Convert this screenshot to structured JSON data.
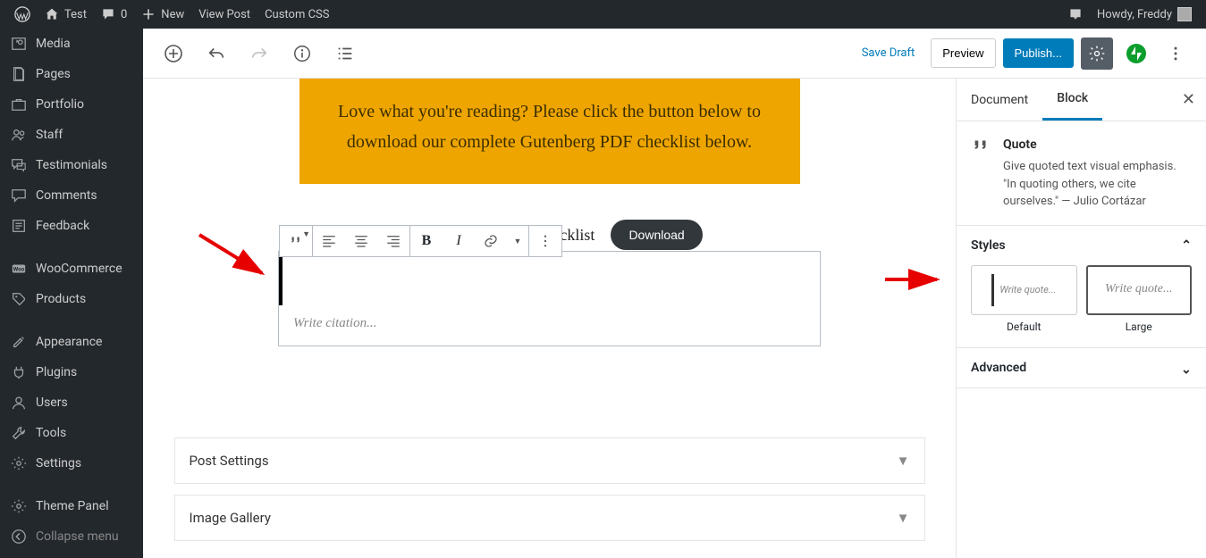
{
  "admin_bar": {
    "site_name": "Test",
    "comments_count": "0",
    "new_label": "New",
    "view_post": "View Post",
    "custom_css": "Custom CSS",
    "howdy": "Howdy, Freddy"
  },
  "admin_menu": [
    {
      "label": "Media",
      "icon": "media"
    },
    {
      "label": "Pages",
      "icon": "page"
    },
    {
      "label": "Portfolio",
      "icon": "portfolio"
    },
    {
      "label": "Staff",
      "icon": "users"
    },
    {
      "label": "Testimonials",
      "icon": "chat"
    },
    {
      "label": "Comments",
      "icon": "comment"
    },
    {
      "label": "Feedback",
      "icon": "form"
    }
  ],
  "admin_menu2": [
    {
      "label": "WooCommerce",
      "icon": "woo"
    },
    {
      "label": "Products",
      "icon": "product"
    }
  ],
  "admin_menu3": [
    {
      "label": "Appearance",
      "icon": "appearance"
    },
    {
      "label": "Plugins",
      "icon": "plugin"
    },
    {
      "label": "Users",
      "icon": "user"
    },
    {
      "label": "Tools",
      "icon": "tool"
    },
    {
      "label": "Settings",
      "icon": "settings"
    }
  ],
  "admin_menu4": [
    {
      "label": "Theme Panel",
      "icon": "settings"
    },
    {
      "label": "Collapse menu",
      "icon": "collapse"
    }
  ],
  "editor_header": {
    "save_draft": "Save Draft",
    "preview": "Preview",
    "publish": "Publish..."
  },
  "canvas": {
    "yellow_text": "Love what you're reading? Please click the button below to download our complete Gutenberg PDF checklist below.",
    "pdf_label": "Free Gutenberg PDF Checklist",
    "download": "Download",
    "citation_ph": "Write citation...",
    "sections": [
      "Post Settings",
      "Image Gallery"
    ]
  },
  "panel": {
    "tabs": [
      "Document",
      "Block"
    ],
    "block_title": "Quote",
    "block_desc": "Give quoted text visual emphasis. \"In quoting others, we cite ourselves.\" — Julio Cortázar",
    "styles_title": "Styles",
    "styles": [
      {
        "name": "Default",
        "ph": "Write quote..."
      },
      {
        "name": "Large",
        "ph": "Write quote..."
      }
    ],
    "advanced": "Advanced"
  }
}
